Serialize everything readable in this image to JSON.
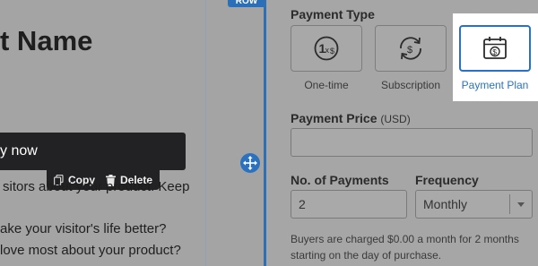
{
  "editor": {
    "product_name": "t Name",
    "cta_text": "y now",
    "toolbar": {
      "copy_label": "Copy",
      "delete_label": "Delete"
    },
    "body_lines": [
      "sitors about your product. Keep",
      "ake your visitor's life better?",
      " love most about your product?",
      ""
    ]
  },
  "layout_badge": "ROW",
  "panel": {
    "payment_type_label": "Payment Type",
    "payment_types": [
      {
        "label": "One-time",
        "icon": "one-time-dollar-icon",
        "selected": false
      },
      {
        "label": "Subscription",
        "icon": "recurring-dollar-icon",
        "selected": false
      },
      {
        "label": "Payment Plan",
        "icon": "calendar-dollar-icon",
        "selected": true
      }
    ],
    "price_label": "Payment Price",
    "price_currency": "(USD)",
    "price_value": "",
    "payments_label": "No. of Payments",
    "payments_value": "2",
    "frequency_label": "Frequency",
    "frequency_value": "Monthly",
    "help_text": "Buyers are charged $0.00 a month for 2 months starting on the day of purchase."
  },
  "colors": {
    "accent": "#2a72bf",
    "overlay_gray": "#a4a4a4",
    "toolbar_dark": "#222224"
  }
}
